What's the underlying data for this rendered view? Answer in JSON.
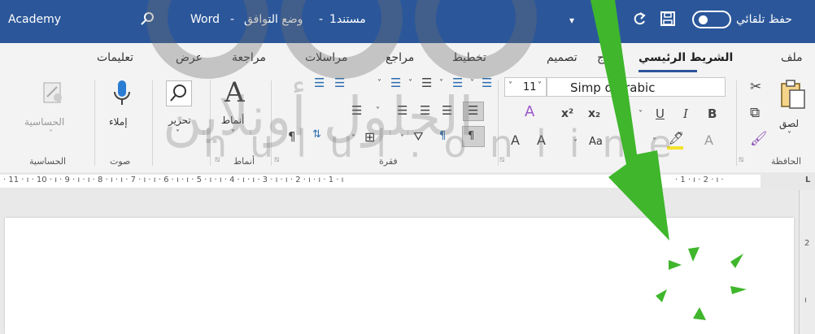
{
  "titlebar": {
    "account": "Academy",
    "app": "Word",
    "dash1": "-",
    "compat_mode": "وضع التوافق",
    "dash2": "-",
    "doc_name": "مستند1",
    "autosave": "حفظ تلقائي"
  },
  "tabs": {
    "file": "ملف",
    "home": "الشريط الرئيسي",
    "insert_partial": "ج",
    "design": "تصميم",
    "layout": "تخطيط",
    "references": "مراجع",
    "mailings": "مراسلات",
    "review": "مراجعة",
    "view": "عرض",
    "help": "تعليمات"
  },
  "ribbon": {
    "clipboard": {
      "paste": "لصق",
      "group": "الحافظة"
    },
    "font": {
      "name": "Simp  d Arabic",
      "size": "11",
      "bold": "B",
      "italic": "I",
      "underline": "U",
      "aa": "Aa",
      "grow": "A",
      "shrink": "A"
    },
    "paragraph": {
      "group": "فقرة"
    },
    "styles": {
      "label": "أنماط",
      "group": "أنماط"
    },
    "editing": {
      "label": "تحرير"
    },
    "voice": {
      "dictate": "إملاء",
      "group": "صوت"
    },
    "sensitivity": {
      "label": "الحساسية",
      "group": "الحساسية"
    }
  },
  "ruler": {
    "left": "· 11 · ı · 10 · ı · 9 · ı · ı · 8 · ı · ı · 7 · ı · ı · 6 · ı · ı · 5 · ı · ı · 4 · ı · ı · 3 · ı · ı · 2 · ı · ı · 1 · ı",
    "right": "· 1 · ı · 2 · ı ·"
  },
  "watermark": {
    "arabic": "الحلول أونلاين",
    "latin": "hulul.online"
  },
  "colors": {
    "title_blue": "#2b579a",
    "arrow_green": "#3fb62c",
    "highlight_yellow": "#f4e22b"
  }
}
